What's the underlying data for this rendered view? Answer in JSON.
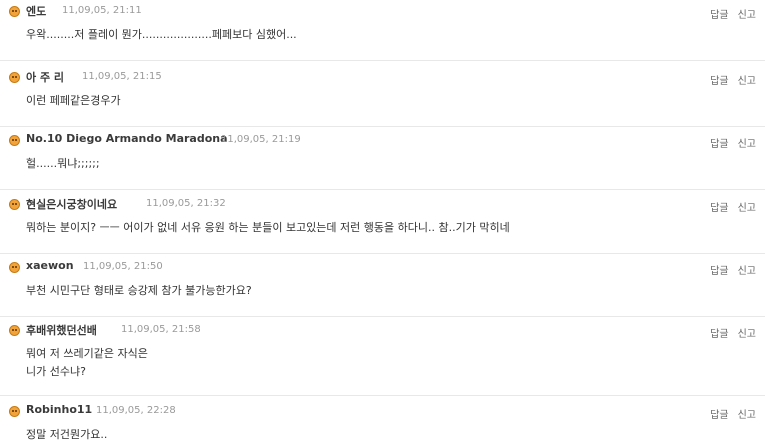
{
  "actions": {
    "reply_label": "답글",
    "report_label": "신고"
  },
  "comments": [
    {
      "author": "엔도",
      "time": "11,09,05, 21:11",
      "lines": [
        "우왁........저 플레이 뭔가....................페페보다 심했어..."
      ]
    },
    {
      "author": "아 주 리",
      "time": "11,09,05, 21:15",
      "lines": [
        "이런 페페같은경우가"
      ]
    },
    {
      "author": "No.10 Diego Armando Maradona",
      "time": "11,09,05, 21:19",
      "lines": [
        "헐......뭐냐;;;;;;"
      ]
    },
    {
      "author": "현실은시궁창이네요",
      "time": "11,09,05, 21:32",
      "lines": [
        "뭐하는 분이지? ㅡㅡ 어이가 없네 서유 응원 하는 분들이 보고있는데 저런 행동을 하다니.. 참..기가 막히네"
      ]
    },
    {
      "author": "xaewon",
      "time": "11,09,05, 21:50",
      "lines": [
        "부천 시민구단 형태로 승강제 참가 불가능한가요?"
      ]
    },
    {
      "author": "후배위했던선배",
      "time": "11,09,05, 21:58",
      "lines": [
        "뭐여 저 쓰레기같은 자식은",
        "니가 선수냐?"
      ]
    },
    {
      "author": "Robinho11",
      "time": "11,09,05, 22:28",
      "lines": [
        "정말 저건뭔가요.."
      ]
    }
  ]
}
